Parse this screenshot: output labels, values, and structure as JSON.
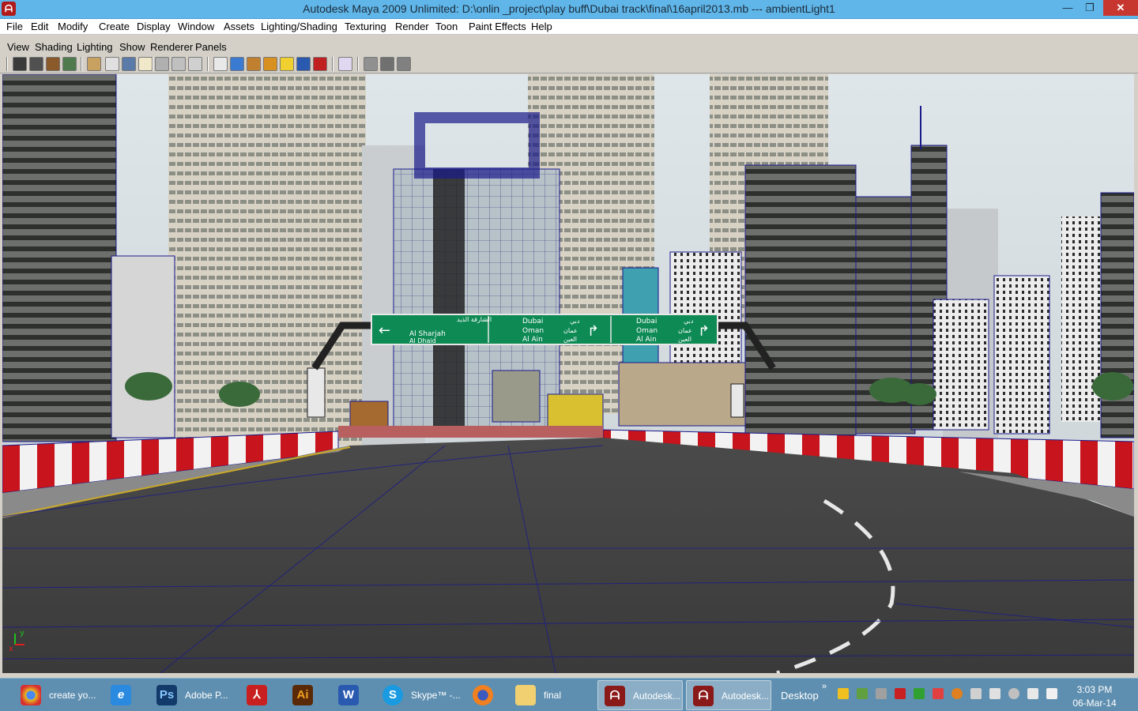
{
  "window": {
    "title": "Autodesk Maya 2009 Unlimited: D:\\onlin _project\\play buff\\Dubai track\\final\\16april2013.mb   ---   ambientLight1",
    "app_icon": "maya-icon"
  },
  "menubar": {
    "items": [
      "File",
      "Edit",
      "Modify",
      "Create",
      "Display",
      "Window",
      "Assets",
      "Lighting/Shading",
      "Texturing",
      "Render",
      "Toon",
      "Paint Effects",
      "Help"
    ]
  },
  "panel_menu": {
    "items": [
      "View",
      "Shading",
      "Lighting",
      "Show",
      "Renderer",
      "Panels"
    ]
  },
  "toolbar": {
    "icons": [
      "select-camera-icon",
      "lock-camera-icon",
      "camera-attributes-icon",
      "bookmark-icon",
      "image-plane-icon",
      "grid-icon",
      "film-gate-icon",
      "resolution-gate-icon",
      "gate-mask-icon",
      "field-chart-icon",
      "safe-action-icon",
      "safe-title-icon",
      "wireframe-icon",
      "smooth-shade-icon",
      "flat-shade-icon",
      "textured-icon",
      "lights-icon",
      "shadows-icon",
      "isolate-select-icon",
      "xray-icon",
      "xray-joints-icon",
      "backface-icon"
    ]
  },
  "viewport": {
    "sign": {
      "left_panel": {
        "arabic": "الشارقة الذيد",
        "lines": [
          "Al Sharjah",
          "Al Dhaid"
        ]
      },
      "mid_panel": {
        "arabic_top": "دبي",
        "arabic_mid": "عمان",
        "arabic_bottom": "العين",
        "lines": [
          "Dubai",
          "Oman",
          "Al Ain"
        ]
      },
      "right_panel": {
        "arabic_top": "دبي",
        "arabic_mid": "عمان",
        "arabic_bottom": "العين",
        "lines": [
          "Dubai",
          "Oman",
          "Al Ain"
        ]
      }
    },
    "axis": {
      "x": "x",
      "y": "y"
    },
    "colors": {
      "sign": "#0e8a55",
      "road": "#3d3d3d",
      "barrier_red": "#c8141c",
      "wire": "#1a1a8a"
    }
  },
  "taskbar": {
    "tasks": [
      {
        "label": "create yo...",
        "icon": "chrome-icon"
      },
      {
        "label": "",
        "icon": "internet-explorer-icon"
      },
      {
        "label": "Adobe P...",
        "icon": "photoshop-icon"
      },
      {
        "label": "",
        "icon": "acrobat-icon"
      },
      {
        "label": "",
        "icon": "illustrator-icon"
      },
      {
        "label": "",
        "icon": "word-icon"
      },
      {
        "label": "Skype™ -...",
        "icon": "skype-icon"
      },
      {
        "label": "",
        "icon": "firefox-icon"
      },
      {
        "label": "final",
        "icon": "folder-icon"
      },
      {
        "label": "Autodesk...",
        "icon": "maya-icon"
      },
      {
        "label": "Autodesk...",
        "icon": "maya-icon"
      }
    ],
    "desktop_label": "Desktop",
    "chevron": "»",
    "clock_time": "3:03 PM",
    "clock_date": "06-Mar-14"
  }
}
